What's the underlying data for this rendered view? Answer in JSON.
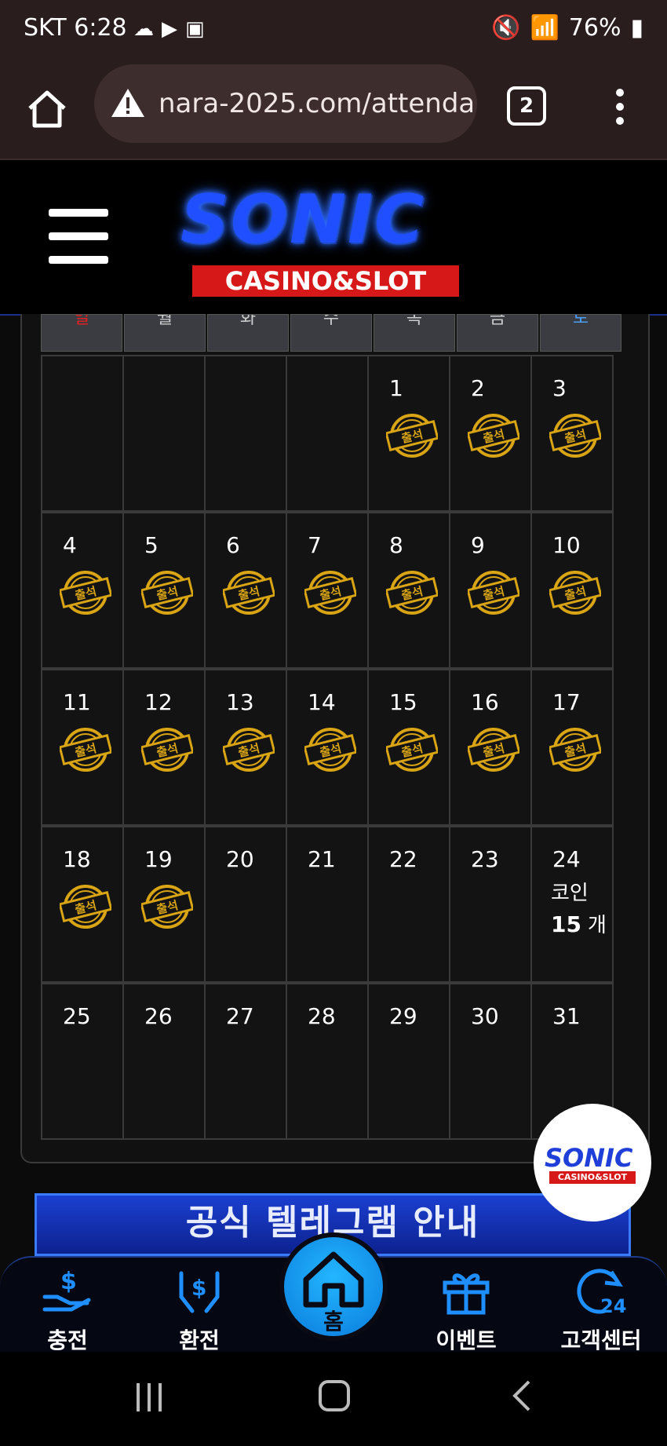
{
  "status_bar": {
    "time": "SKT 6:28",
    "battery": "76%"
  },
  "browser": {
    "url": "nara-2025.com/attenda",
    "tab_count": "2"
  },
  "header": {
    "logo_main": "SONIC",
    "logo_sub": "CASINO&SLOT"
  },
  "calendar": {
    "day_headers": [
      "일",
      "월",
      "화",
      "수",
      "목",
      "금",
      "토"
    ],
    "stamp_text": "출석",
    "weeks": [
      [
        {
          "day": ""
        },
        {
          "day": ""
        },
        {
          "day": ""
        },
        {
          "day": ""
        },
        {
          "day": "1",
          "stamp": true
        },
        {
          "day": "2",
          "stamp": true
        },
        {
          "day": "3",
          "stamp": true
        }
      ],
      [
        {
          "day": "4",
          "stamp": true
        },
        {
          "day": "5",
          "stamp": true
        },
        {
          "day": "6",
          "stamp": true
        },
        {
          "day": "7",
          "stamp": true
        },
        {
          "day": "8",
          "stamp": true
        },
        {
          "day": "9",
          "stamp": true
        },
        {
          "day": "10",
          "stamp": true
        }
      ],
      [
        {
          "day": "11",
          "stamp": true
        },
        {
          "day": "12",
          "stamp": true
        },
        {
          "day": "13",
          "stamp": true
        },
        {
          "day": "14",
          "stamp": true
        },
        {
          "day": "15",
          "stamp": true
        },
        {
          "day": "16",
          "stamp": true
        },
        {
          "day": "17",
          "stamp": true
        }
      ],
      [
        {
          "day": "18",
          "stamp": true
        },
        {
          "day": "19",
          "stamp": true
        },
        {
          "day": "20"
        },
        {
          "day": "21"
        },
        {
          "day": "22"
        },
        {
          "day": "23"
        },
        {
          "day": "24",
          "reward": {
            "label": "코인",
            "amount": "15",
            "unit": "개"
          }
        }
      ],
      [
        {
          "day": "25"
        },
        {
          "day": "26"
        },
        {
          "day": "27"
        },
        {
          "day": "28"
        },
        {
          "day": "29"
        },
        {
          "day": "30"
        },
        {
          "day": "31"
        }
      ]
    ]
  },
  "banner": {
    "text": "공식 텔레그램 안내"
  },
  "floating_logo": {
    "main": "SONIC",
    "sub": "CASINO&SLOT"
  },
  "bottom_nav": {
    "items": [
      {
        "label": "충전",
        "icon": "deposit-icon"
      },
      {
        "label": "환전",
        "icon": "withdraw-icon"
      },
      {
        "label": "홈",
        "icon": "home-icon"
      },
      {
        "label": "이벤트",
        "icon": "gift-icon"
      },
      {
        "label": "고객센터",
        "icon": "support-24-icon"
      }
    ]
  },
  "colors": {
    "accent_blue": "#1f8fff",
    "stamp_gold": "#d9a514",
    "brand_red": "#d61818"
  }
}
